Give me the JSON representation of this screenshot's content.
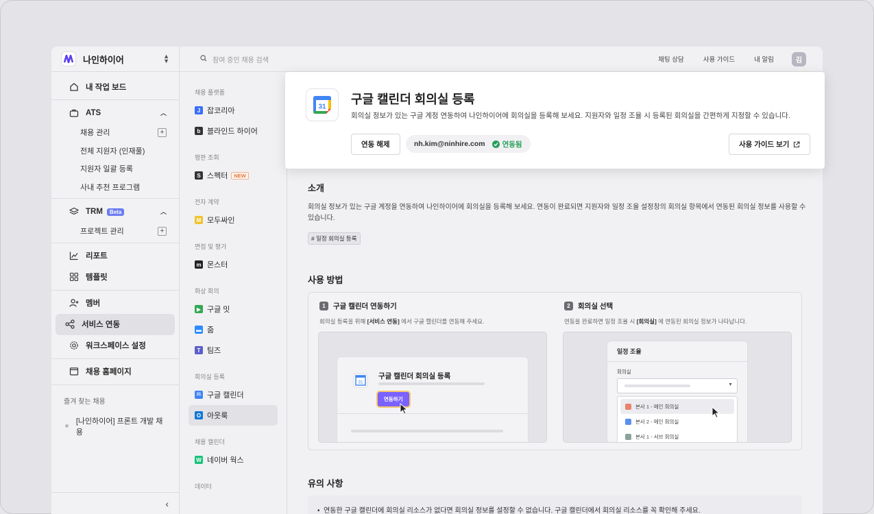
{
  "workspace": {
    "name": "나인하이어"
  },
  "nav": {
    "dashboard": "내 작업 보드",
    "ats": "ATS",
    "ats_items": [
      "채용 관리",
      "전체 지원자 (인재풀)",
      "지원자 일괄 등록",
      "사내 추천 프로그램"
    ],
    "trm": "TRM",
    "trm_badge": "Beta",
    "trm_items": [
      "프로젝트 관리"
    ],
    "report": "리포트",
    "template": "템플릿",
    "member": "멤버",
    "integrations": "서비스 연동",
    "workspace_settings": "워크스페이스 설정",
    "career_page": "채용 홈페이지",
    "favorites_title": "즐겨 찾는 채용",
    "favorites": [
      "[나인하이어] 프론트 개발 채용"
    ]
  },
  "search": {
    "placeholder": "참여 중인 채용 검색"
  },
  "topbar": {
    "chat": "채팅 상담",
    "guide": "사용 가이드",
    "notifications": "내 알림",
    "avatar": "김"
  },
  "categories": [
    {
      "title": "채용 플랫폼",
      "items": [
        {
          "label": "잡코리아",
          "icon": "J",
          "color": "#3a6ff7"
        },
        {
          "label": "블라인드 하이어",
          "icon": "b",
          "color": "#333333"
        }
      ]
    },
    {
      "title": "평판 조회",
      "items": [
        {
          "label": "스펙터",
          "icon": "S",
          "color": "#333333",
          "badge": "NEW"
        }
      ]
    },
    {
      "title": "전자 계약",
      "items": [
        {
          "label": "모두싸인",
          "icon": "M",
          "color": "#f2c230"
        }
      ]
    },
    {
      "title": "면접 및 평가",
      "items": [
        {
          "label": "몬스터",
          "icon": "m",
          "color": "#222222"
        }
      ]
    },
    {
      "title": "화상 회의",
      "items": [
        {
          "label": "구글 밋",
          "icon": "▶",
          "color": "#34a853"
        },
        {
          "label": "줌",
          "icon": "▬",
          "color": "#2d8cff"
        },
        {
          "label": "팀즈",
          "icon": "T",
          "color": "#5b5fc7"
        }
      ]
    },
    {
      "title": "회의실 등록",
      "items": [
        {
          "label": "구글 캘린더",
          "icon": "31",
          "color": "#4285f4"
        },
        {
          "label": "아웃룩",
          "icon": "O",
          "color": "#0f78d4",
          "active": true
        }
      ]
    },
    {
      "title": "채용 캘린더",
      "items": [
        {
          "label": "네이버 웍스",
          "icon": "W",
          "color": "#19c27b"
        }
      ]
    },
    {
      "title": "데이터",
      "items": []
    }
  ],
  "integration": {
    "title": "구글 캘린더 회의실 등록",
    "description": "회의실 정보가 있는 구글 계정 연동하여 나인하이어에 회의실을 등록해 보세요. 지원자와 일정 조율 시 등록된 회의실을 간편하게 지정할 수 있습니다.",
    "disconnect": "연동 해제",
    "account": "nh.kim@ninhire.com",
    "status": "연동됨",
    "guide_button": "사용 가이드 보기"
  },
  "intro": {
    "heading": "소개",
    "text": "회의실 정보가 있는 구글 계정을 연동하여 나인하이어에 회의실을 등록해 보세요. 연동이 완료되면 지원자와 일정 조율 설정창의 회의실 항목에서 연동된 회의실 정보를 사용할 수 있습니다.",
    "tag": "# 일정 회의실 등록"
  },
  "howto": {
    "heading": "사용 방법",
    "step1": {
      "num": "1",
      "title": "구글 캘린더 연동하기",
      "desc_pre": "회의실 등록을 위해 ",
      "desc_bold": "[서비스 연동]",
      "desc_post": " 에서 구글 캘린더를 연동해 주세요.",
      "card_title": "구글 캘린더 회의실 등록",
      "button": "연동하기"
    },
    "step2": {
      "num": "2",
      "title": "회의실 선택",
      "desc_pre": "연동을 완료하면 일정 조율 시 ",
      "desc_bold": "[회의실]",
      "desc_post": " 에 연동된 회의실 정보가 나타납니다.",
      "card_title": "일정 조율",
      "field_label": "회의실",
      "options": [
        {
          "label": "본사 1 - 메인 회의실",
          "color": "#e8826a"
        },
        {
          "label": "본사 2 - 메인 회의실",
          "color": "#5b8ff0"
        },
        {
          "label": "본사 1 - 서브 회의실",
          "color": "#8aa39a"
        }
      ]
    }
  },
  "notes": {
    "heading": "유의 사항",
    "items": [
      "연동한 구글 캘린더에 회의실 리소스가 없다면 회의실 정보를 설정할 수 없습니다. 구글 캘린더에서 회의실 리소스를 꼭 확인해 주세요."
    ]
  }
}
